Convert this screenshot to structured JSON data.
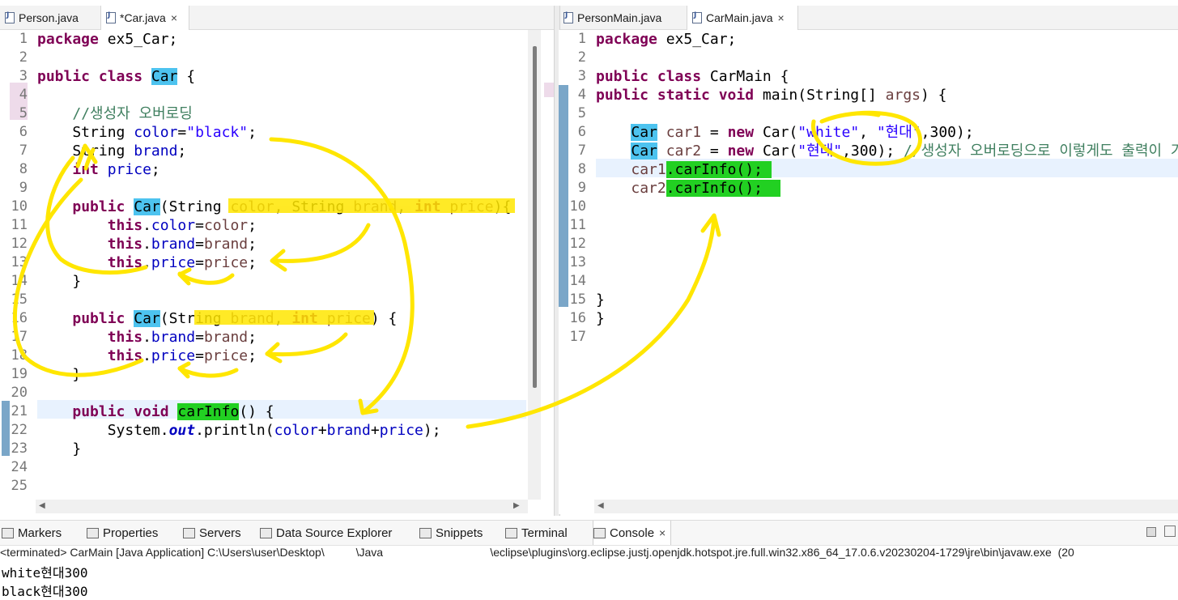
{
  "left_tabs": [
    {
      "label": "Person.java",
      "active": false
    },
    {
      "label": "*Car.java",
      "active": true,
      "close": "×"
    }
  ],
  "right_tabs": [
    {
      "label": "PersonMain.java",
      "active": false
    },
    {
      "label": "CarMain.java",
      "active": true,
      "close": "×"
    }
  ],
  "car_java": {
    "line_numbers": [
      "1",
      "2",
      "3",
      "4",
      "5",
      "6",
      "7",
      "8",
      "9",
      "10",
      "11",
      "12",
      "13",
      "14",
      "15",
      "16",
      "17",
      "18",
      "19",
      "20",
      "21",
      "22",
      "23",
      "24",
      "25"
    ]
  },
  "carmain_java": {
    "line_numbers": [
      "1",
      "2",
      "3",
      "4",
      "5",
      "6",
      "7",
      "8",
      "9",
      "10",
      "11",
      "12",
      "13",
      "14",
      "15",
      "16",
      "17"
    ]
  },
  "bottom_views": [
    {
      "label": "Markers",
      "icon": "markers-icon"
    },
    {
      "label": "Properties",
      "icon": "properties-icon"
    },
    {
      "label": "Servers",
      "icon": "servers-icon"
    },
    {
      "label": "Data Source Explorer",
      "icon": "data-source-icon"
    },
    {
      "label": "Snippets",
      "icon": "snippets-icon"
    },
    {
      "label": "Terminal",
      "icon": "terminal-icon"
    },
    {
      "label": "Console",
      "icon": "console-icon",
      "active": true,
      "close": "×"
    }
  ],
  "console": {
    "header": "<terminated> CarMain [Java Application] C:\\Users\\user\\Desktop\\          \\Java                                  \\eclipse\\plugins\\org.eclipse.justj.openjdk.hotspot.jre.full.win32.x86_64_17.0.6.v20230204-1729\\jre\\bin\\javaw.exe  (20",
    "output": [
      "white현대300",
      "black현대300"
    ]
  },
  "colors": {
    "highlight_class": "#4dc3ef",
    "highlight_method": "#22d022",
    "annotation": "#ffe600",
    "keyword": "#7f0055",
    "string": "#2a00ff",
    "field": "#0000c0",
    "comment": "#3f7f5f"
  }
}
